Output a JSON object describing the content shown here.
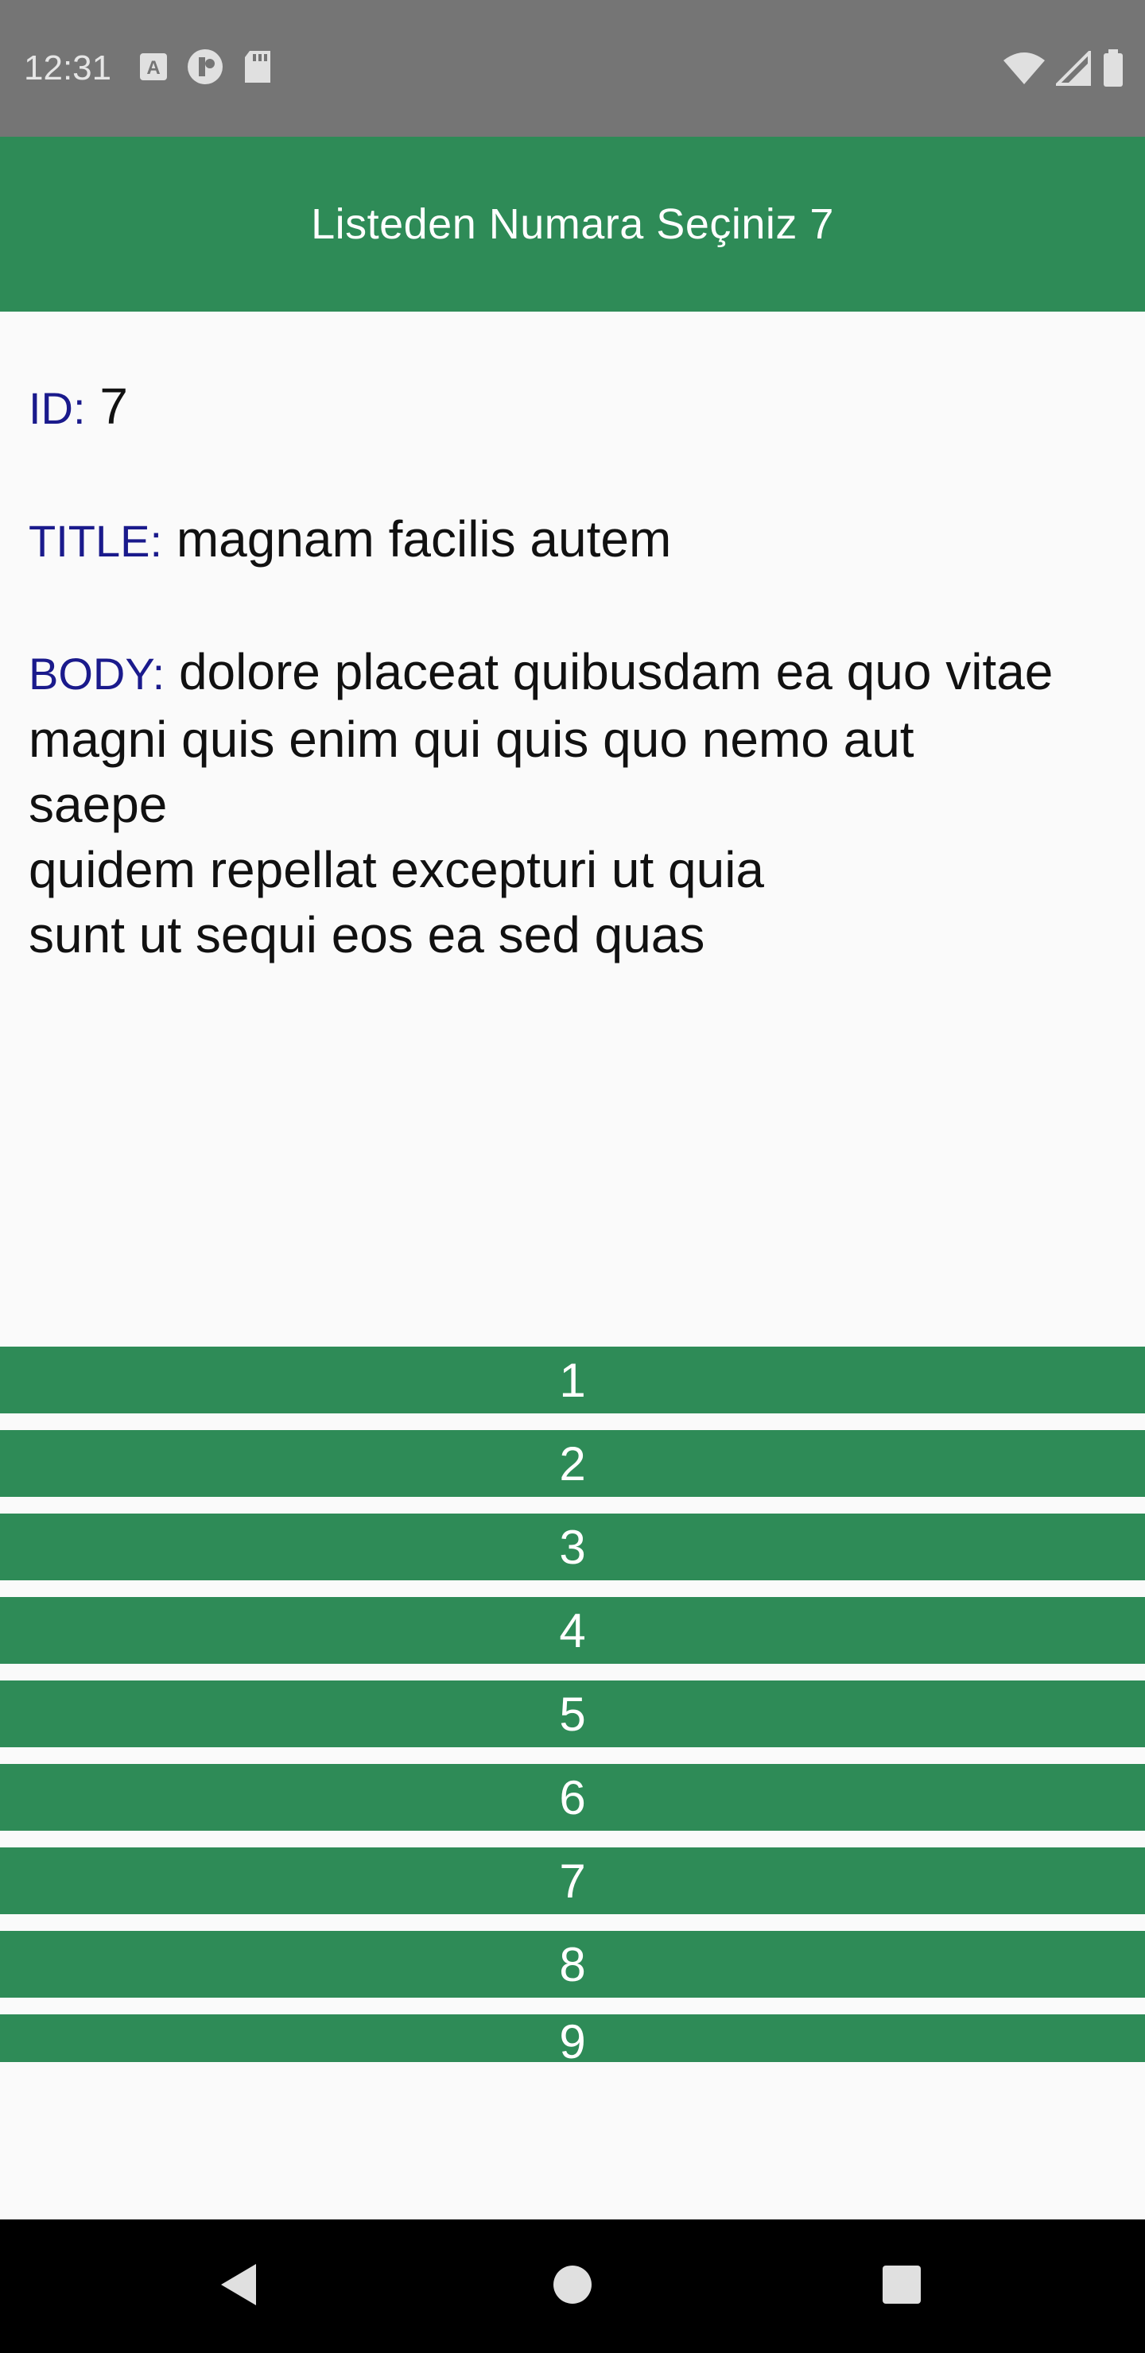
{
  "status_bar": {
    "time": "12:31",
    "left_icons": [
      "a-keyboard-icon",
      "circle-notification-icon",
      "sd-card-icon"
    ],
    "right_icons": [
      "wifi-icon",
      "cell-signal-icon",
      "battery-icon"
    ],
    "background": "#757575"
  },
  "app_bar": {
    "title": "Listeden Numara Seçiniz 7",
    "background": "#2e8b57"
  },
  "detail": {
    "id_label": "ID:",
    "id_value": "7",
    "title_label": "TITLE:",
    "title_value": "magnam facilis autem",
    "body_label": "BODY:",
    "body_value": "dolore placeat quibusdam ea quo vitae\nmagni quis enim qui quis quo nemo aut\nsaepe\nquidem repellat excepturi ut quia\nsunt ut sequi eos ea sed quas",
    "label_color": "#1a1a8c"
  },
  "numbers": [
    "1",
    "2",
    "3",
    "4",
    "5",
    "6",
    "7",
    "8",
    "9"
  ],
  "nav_bar": {
    "buttons": [
      "back-icon",
      "home-icon",
      "recents-icon"
    ]
  }
}
